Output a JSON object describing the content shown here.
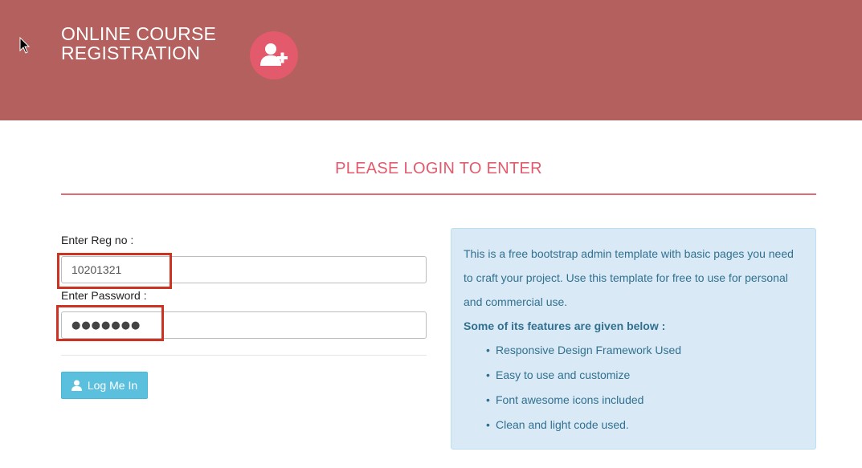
{
  "header": {
    "brand_line1": "ONLINE COURSE",
    "brand_line2": "REGISTRATION",
    "logo_icon": "user-plus-icon",
    "background_color": "#b3605e",
    "accent_color": "#e35a6c"
  },
  "main": {
    "heading": "PLEASE LOGIN TO ENTER"
  },
  "login_form": {
    "regno_label": "Enter Reg no :",
    "regno_value": "10201321",
    "password_label": "Enter Password :",
    "password_value": "●●●●●●●",
    "submit_label": "Log Me In",
    "submit_icon": "user-icon"
  },
  "info_panel": {
    "text": "This is a free bootstrap admin template with basic pages you need to craft your project. Use this template for free to use for personal and commercial use.",
    "features_title": "Some of its features are given below :",
    "features": [
      "Responsive Design Framework Used",
      "Easy to use and customize",
      "Font awesome icons included",
      "Clean and light code used."
    ]
  }
}
